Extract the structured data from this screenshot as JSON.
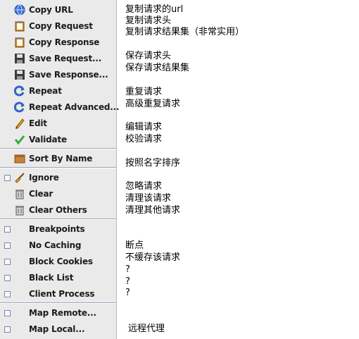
{
  "menu": {
    "items": [
      {
        "label": "Copy URL",
        "icon": "globe-icon"
      },
      {
        "label": "Copy Request",
        "icon": "clipboard-icon"
      },
      {
        "label": "Copy Response",
        "icon": "clipboard-icon"
      },
      {
        "label": "Save Request...",
        "icon": "floppy-disk-icon"
      },
      {
        "label": "Save Response...",
        "icon": "floppy-disk-icon"
      },
      {
        "label": "Repeat",
        "icon": "refresh-icon"
      },
      {
        "label": "Repeat Advanced...",
        "icon": "refresh-icon"
      },
      {
        "label": "Edit",
        "icon": "pencil-icon"
      },
      {
        "label": "Validate",
        "icon": "checkmark-icon"
      },
      {
        "label": "Sort By Name",
        "icon": "box-icon"
      },
      {
        "label": "Ignore",
        "icon": "broom-icon"
      },
      {
        "label": "Clear",
        "icon": "trash-icon"
      },
      {
        "label": "Clear Others",
        "icon": "trash-icon"
      },
      {
        "label": "Breakpoints",
        "icon": "checkbox-icon"
      },
      {
        "label": "No Caching",
        "icon": "checkbox-icon"
      },
      {
        "label": "Block Cookies",
        "icon": "checkbox-icon"
      },
      {
        "label": "Black List",
        "icon": "checkbox-icon"
      },
      {
        "label": "Client Process",
        "icon": "checkbox-icon"
      },
      {
        "label": "Map Remote...",
        "icon": "checkbox-icon"
      },
      {
        "label": "Map Local...",
        "icon": "checkbox-icon"
      }
    ]
  },
  "notes": {
    "copy_url": "复制请求的url",
    "copy_request": "复制请求头",
    "copy_response": "复制请求结果集（非常实用）",
    "save_request": "保存请求头",
    "save_response": "保存请求结果集",
    "repeat": "重复请求",
    "repeat_advanced": "高级重复请求",
    "edit": "编辑请求",
    "validate": "校验请求",
    "sort_by_name": "按照名字排序",
    "ignore": "忽略请求",
    "clear": "清理该请求",
    "clear_others": "清理其他请求",
    "breakpoints": "断点",
    "no_caching": "不缓存该请求",
    "block_cookies": "?",
    "black_list": "?",
    "client_process": "?",
    "map_remote": "远程代理"
  },
  "colors": {
    "menu_bg": "#eaeaea",
    "text": "#1c1c1c",
    "separator": "#9aa6c0"
  }
}
